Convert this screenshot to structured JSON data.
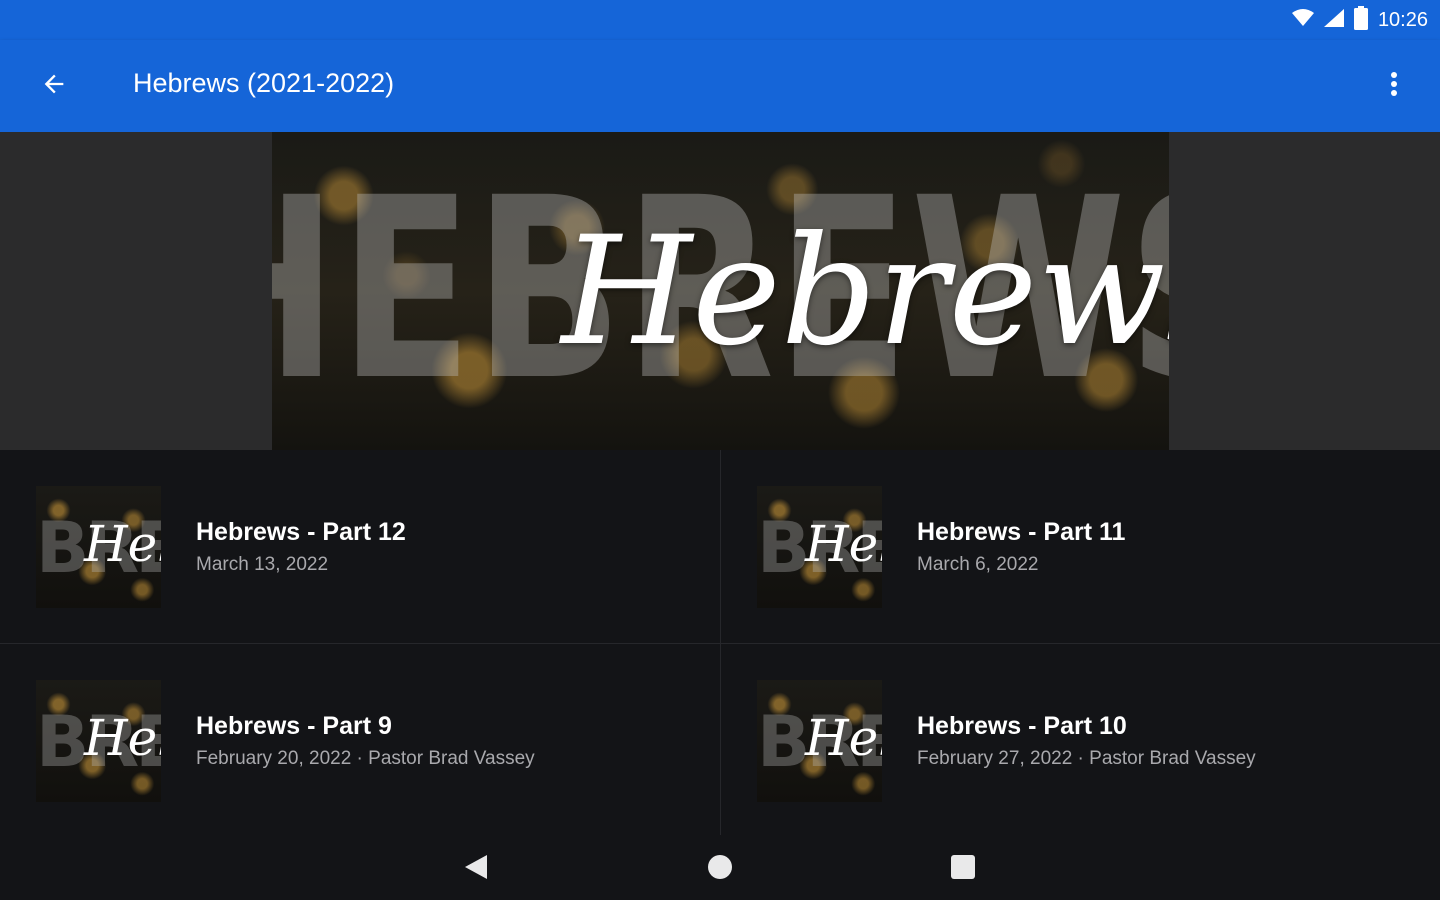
{
  "status_bar": {
    "time": "10:26",
    "icons": [
      "wifi-icon",
      "cell-signal-icon",
      "battery-icon"
    ]
  },
  "app_bar": {
    "title": "Hebrews (2021-2022)",
    "back_icon": "arrow-back-icon",
    "menu_icon": "more-vert-icon",
    "color": "#1565d8"
  },
  "hero": {
    "block_text": "HEBREWS",
    "script_text": "Hebrews"
  },
  "thumbnail": {
    "block_text": "BRE",
    "script_text": "Heb"
  },
  "items": [
    {
      "title": "Hebrews - Part 12",
      "subtitle": "March 13, 2022"
    },
    {
      "title": "Hebrews - Part 11",
      "subtitle": "March 6, 2022"
    },
    {
      "title": "Hebrews - Part 9",
      "subtitle": "February 20, 2022 · Pastor Brad Vassey"
    },
    {
      "title": "Hebrews - Part 10",
      "subtitle": "February 27, 2022 · Pastor Brad Vassey"
    }
  ],
  "nav_bar": {
    "icons": [
      "nav-back-icon",
      "nav-home-icon",
      "nav-recents-icon"
    ]
  }
}
